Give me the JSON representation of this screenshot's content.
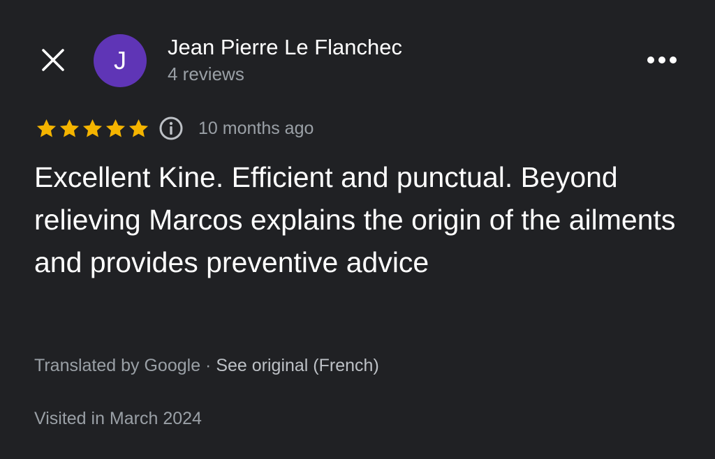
{
  "header": {
    "close_icon": "close-icon",
    "avatar_initial": "J",
    "avatar_color": "#5f35b6",
    "reviewer_name": "Jean Pierre Le Flanchec",
    "reviewer_reviews": "4 reviews",
    "more_icon": "more-horizontal-icon"
  },
  "review": {
    "rating": 5,
    "rating_max": 5,
    "star_color": "#f4b400",
    "info_icon": "info-icon",
    "time_ago": "10 months ago",
    "text": "Excellent Kine. Efficient and punctual. Beyond relieving Marcos explains the origin of the ailments and provides preventive advice",
    "translated_by": "Translated by Google",
    "separator": " · ",
    "see_original": "See original (French)",
    "visited": "Visited in March 2024"
  },
  "colors": {
    "background": "#202124",
    "secondary_text": "#9aa0a6"
  }
}
